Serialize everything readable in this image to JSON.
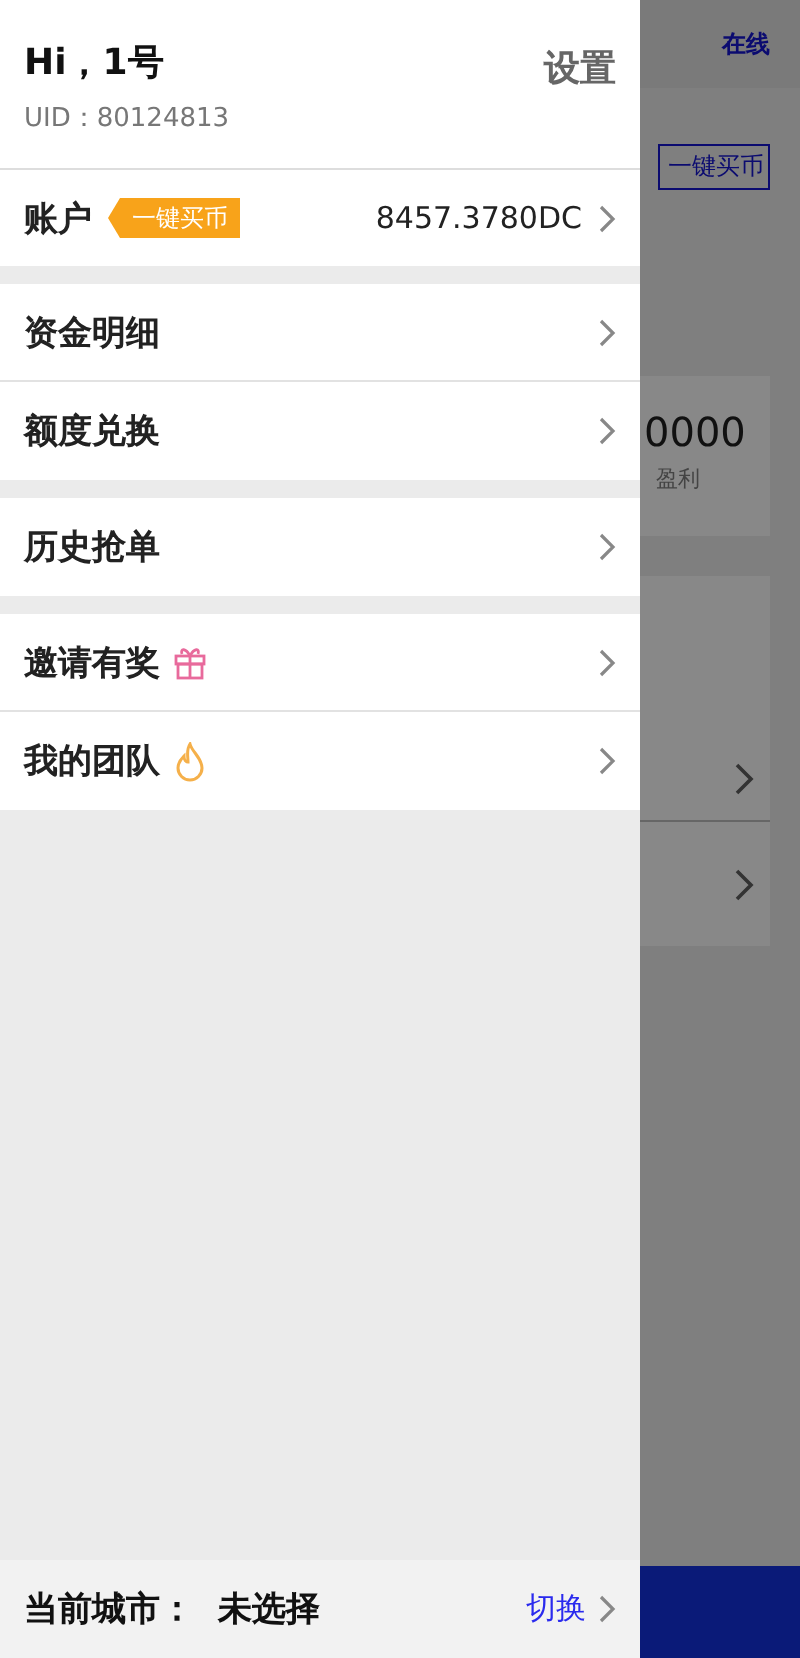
{
  "header": {
    "greeting": "Hi，1号",
    "uid": "UID：80124813",
    "settings": "设置"
  },
  "account": {
    "label": "账户",
    "tag": "一键买币",
    "balance": "8457.3780DC"
  },
  "menu_groups": [
    [
      {
        "label": "资金明细"
      },
      {
        "label": "额度兑换"
      }
    ],
    [
      {
        "label": "历史抢单"
      }
    ],
    [
      {
        "label": "邀请有奖",
        "kind": "gift"
      },
      {
        "label": "我的团队",
        "kind": "fire"
      }
    ]
  ],
  "city": {
    "label": "当前城市：",
    "value": "未选择",
    "action": "切换"
  },
  "background": {
    "status": "在线",
    "buy_button": "一键买币",
    "amount": "0000",
    "amount_label": "盈利"
  }
}
